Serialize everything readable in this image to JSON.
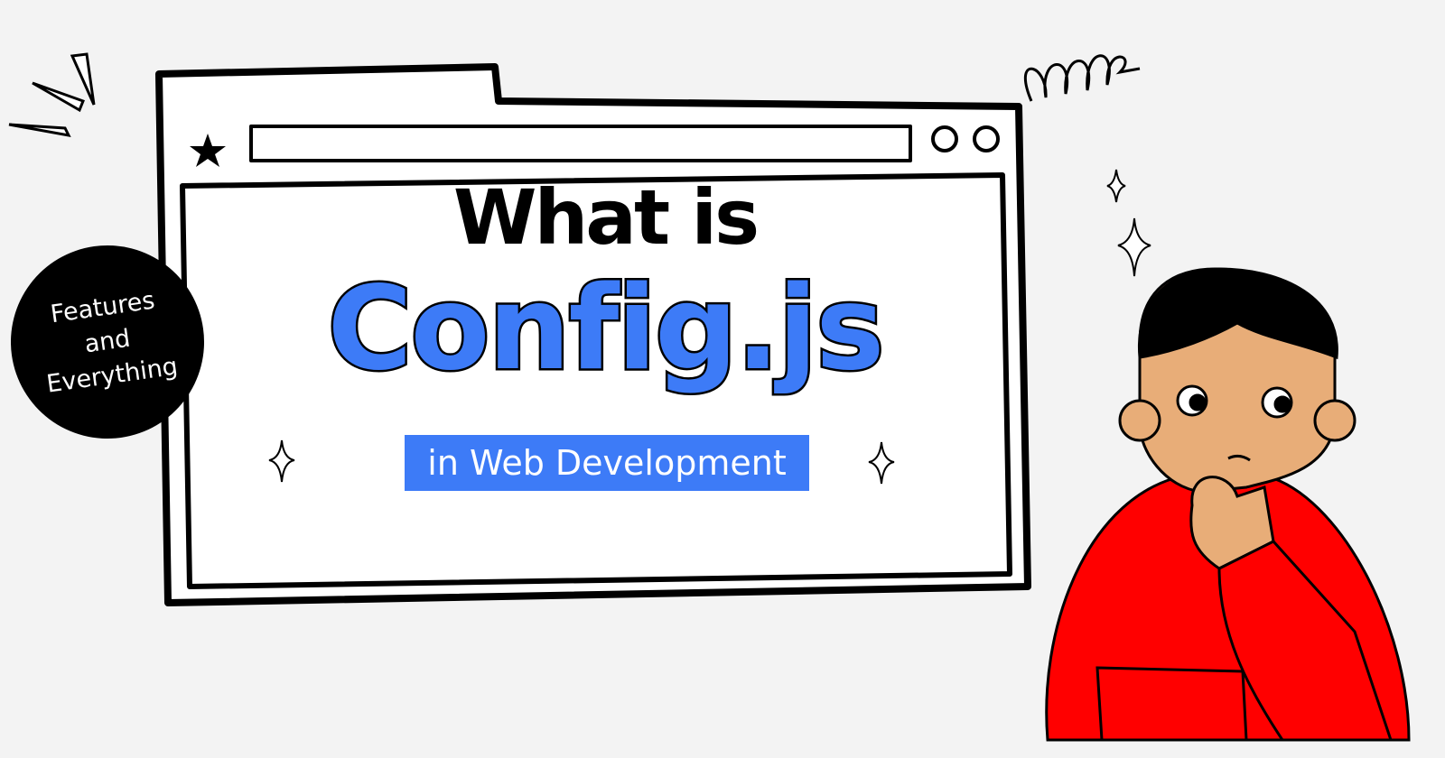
{
  "heading": {
    "line1": "What is",
    "line2": "Config.js",
    "subtitle": "in Web Development"
  },
  "badge": {
    "line1": "Features",
    "line2": "and",
    "line3": "Everything"
  },
  "colors": {
    "accent": "#3d7bf7",
    "background": "#f3f3f3",
    "shirt": "#ff0000",
    "skin": "#e8ad78"
  },
  "icons": [
    "star-icon",
    "sparkle-icon",
    "window-dots-icon",
    "squiggle-icon",
    "thinking-person-illustration"
  ]
}
